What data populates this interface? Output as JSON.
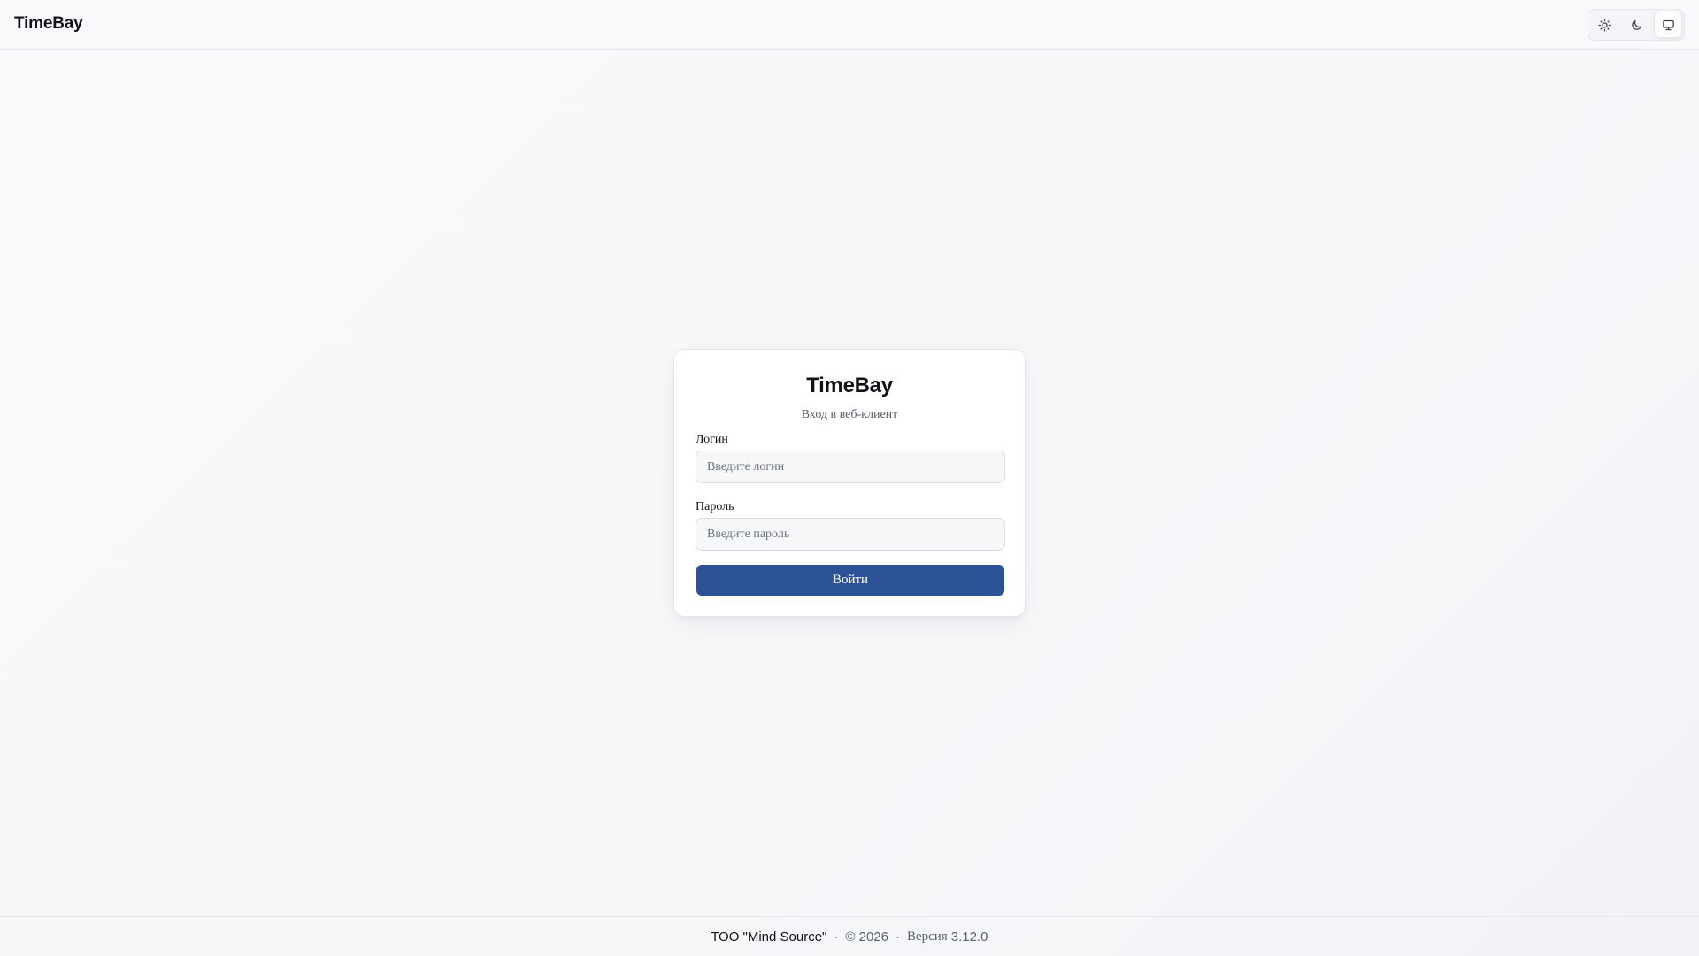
{
  "header": {
    "brand": "TimeBay",
    "theme_buttons": [
      {
        "name": "light",
        "icon": "sun-icon"
      },
      {
        "name": "dark",
        "icon": "moon-icon"
      },
      {
        "name": "system",
        "icon": "monitor-icon",
        "active": true
      }
    ]
  },
  "login": {
    "title": "TimeBay",
    "subtitle": "Вход в веб-клиент",
    "login_label": "Логин",
    "login_placeholder": "Введите логин",
    "login_value": "",
    "password_label": "Пароль",
    "password_placeholder": "Введите пароль",
    "password_value": "",
    "submit_label": "Войти"
  },
  "footer": {
    "company": "ТОО \"Mind Source\"",
    "separator": "·",
    "copyright": "© 2026",
    "version_label": "Версия",
    "version_number": "3.12.0"
  },
  "colors": {
    "primary": "#2b5196",
    "background": "#f8f9fb",
    "border": "#e3e6eb"
  }
}
